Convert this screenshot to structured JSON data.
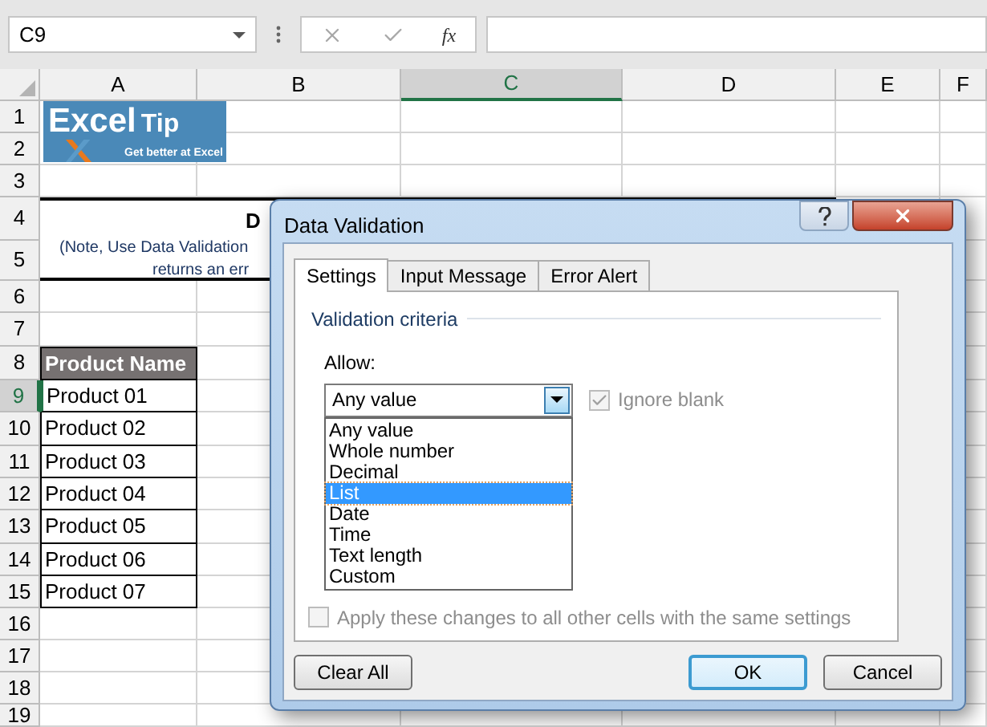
{
  "name_box": {
    "value": "C9"
  },
  "formula_bar": {
    "function_label": "fx"
  },
  "sheet": {
    "columns": [
      {
        "label": "A",
        "selected": false
      },
      {
        "label": "B",
        "selected": false
      },
      {
        "label": "C",
        "selected": true
      },
      {
        "label": "D",
        "selected": false
      },
      {
        "label": "E",
        "selected": false
      },
      {
        "label": "F",
        "selected": false
      }
    ],
    "rows": [
      {
        "label": "1",
        "selected": false
      },
      {
        "label": "2",
        "selected": false
      },
      {
        "label": "3",
        "selected": false
      },
      {
        "label": "4",
        "selected": false
      },
      {
        "label": "5",
        "selected": false
      },
      {
        "label": "6",
        "selected": false
      },
      {
        "label": "7",
        "selected": false
      },
      {
        "label": "8",
        "selected": false
      },
      {
        "label": "9",
        "selected": true
      },
      {
        "label": "10",
        "selected": false
      },
      {
        "label": "11",
        "selected": false
      },
      {
        "label": "12",
        "selected": false
      },
      {
        "label": "13",
        "selected": false
      },
      {
        "label": "14",
        "selected": false
      },
      {
        "label": "15",
        "selected": false
      },
      {
        "label": "16",
        "selected": false
      },
      {
        "label": "17",
        "selected": false
      },
      {
        "label": "18",
        "selected": false
      },
      {
        "label": "19",
        "selected": false
      }
    ],
    "logo": {
      "title": "Excel",
      "accent": "Tip",
      "tagline": "Get better at Excel"
    },
    "title_fragment": "D",
    "note_lines": [
      "(Note, Use Data Validation",
      "returns an err"
    ],
    "table": {
      "header": "Product Name",
      "cells": [
        "Product 01",
        "Product 02",
        "Product 03",
        "Product 04",
        "Product 05",
        "Product 06",
        "Product 07"
      ]
    }
  },
  "dialog": {
    "title": "Data Validation",
    "tabs": [
      {
        "label": "Settings",
        "selected": true
      },
      {
        "label": "Input Message",
        "selected": false
      },
      {
        "label": "Error Alert",
        "selected": false
      }
    ],
    "section_title": "Validation criteria",
    "allow_label": "Allow:",
    "allow_value": "Any value",
    "options": [
      {
        "label": "Any value",
        "selected": false
      },
      {
        "label": "Whole number",
        "selected": false
      },
      {
        "label": "Decimal",
        "selected": false
      },
      {
        "label": "List",
        "selected": true
      },
      {
        "label": "Date",
        "selected": false
      },
      {
        "label": "Time",
        "selected": false
      },
      {
        "label": "Text length",
        "selected": false
      },
      {
        "label": "Custom",
        "selected": false
      }
    ],
    "ignore_blank": {
      "label": "Ignore blank",
      "checked": true,
      "disabled": true
    },
    "apply_all": {
      "label": "Apply these changes to all other cells with the same settings",
      "checked": false,
      "disabled": true
    },
    "buttons": [
      {
        "label": "Clear All",
        "default": false
      },
      {
        "label": "OK",
        "default": true
      },
      {
        "label": "Cancel",
        "default": false
      }
    ]
  }
}
